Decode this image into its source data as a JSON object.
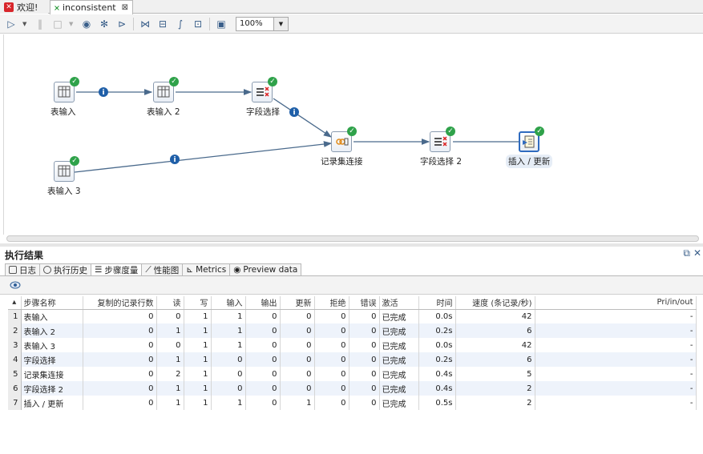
{
  "tabs": [
    {
      "label": "欢迎!",
      "icon": "welcome-icon"
    },
    {
      "label": "inconsistent",
      "icon": "transformation-icon",
      "closable": true
    }
  ],
  "toolbar": {
    "icons": [
      "run-icon",
      "run-options-icon",
      "pause-icon",
      "stop-icon",
      "stop-options-icon",
      "preview-icon",
      "debug-icon",
      "replay-icon",
      "verify-icon",
      "impact-icon",
      "sql-icon",
      "explore-db-icon",
      "show-results-icon"
    ],
    "zoom": "100%"
  },
  "canvas": {
    "nodes": [
      {
        "id": "n1",
        "label": "表输入",
        "type": "table-input"
      },
      {
        "id": "n2",
        "label": "表输入 2",
        "type": "table-input"
      },
      {
        "id": "n3",
        "label": "字段选择",
        "type": "select-values"
      },
      {
        "id": "n4",
        "label": "表输入 3",
        "type": "table-input"
      },
      {
        "id": "n5",
        "label": "记录集连接",
        "type": "merge-join"
      },
      {
        "id": "n6",
        "label": "字段选择 2",
        "type": "select-values"
      },
      {
        "id": "n7",
        "label": "插入 / 更新",
        "type": "insert-update",
        "selected": true
      }
    ],
    "hops": [
      {
        "from": "n1",
        "to": "n2",
        "info": true
      },
      {
        "from": "n2",
        "to": "n3",
        "info": false
      },
      {
        "from": "n3",
        "to": "n5",
        "info": true
      },
      {
        "from": "n4",
        "to": "n5",
        "info": true
      },
      {
        "from": "n5",
        "to": "n6",
        "info": false
      },
      {
        "from": "n6",
        "to": "n7",
        "info": false
      }
    ]
  },
  "results": {
    "title": "执行结果",
    "tabs": [
      {
        "label": "日志",
        "icon": "log-icon"
      },
      {
        "label": "执行历史",
        "icon": "history-icon"
      },
      {
        "label": "步骤度量",
        "icon": "step-metrics-icon",
        "active": true
      },
      {
        "label": "性能图",
        "icon": "performance-chart-icon"
      },
      {
        "label": "Metrics",
        "icon": "metrics-icon"
      },
      {
        "label": "Preview data",
        "icon": "preview-eye-icon"
      }
    ],
    "columns": [
      "步骤名称",
      "复制的记录行数",
      "读",
      "写",
      "输入",
      "输出",
      "更新",
      "拒绝",
      "错误",
      "激活",
      "时间",
      "速度 (条记录/秒)",
      "Pri/in/out"
    ],
    "rows": [
      [
        "1",
        "表输入",
        "0",
        "0",
        "1",
        "1",
        "0",
        "0",
        "0",
        "0",
        "已完成",
        "0.0s",
        "42",
        "-"
      ],
      [
        "2",
        "表输入 2",
        "0",
        "1",
        "1",
        "1",
        "0",
        "0",
        "0",
        "0",
        "已完成",
        "0.2s",
        "6",
        "-"
      ],
      [
        "3",
        "表输入 3",
        "0",
        "0",
        "1",
        "1",
        "0",
        "0",
        "0",
        "0",
        "已完成",
        "0.0s",
        "42",
        "-"
      ],
      [
        "4",
        "字段选择",
        "0",
        "1",
        "1",
        "0",
        "0",
        "0",
        "0",
        "0",
        "已完成",
        "0.2s",
        "6",
        "-"
      ],
      [
        "5",
        "记录集连接",
        "0",
        "2",
        "1",
        "0",
        "0",
        "0",
        "0",
        "0",
        "已完成",
        "0.4s",
        "5",
        "-"
      ],
      [
        "6",
        "字段选择 2",
        "0",
        "1",
        "1",
        "0",
        "0",
        "0",
        "0",
        "0",
        "已完成",
        "0.4s",
        "2",
        "-"
      ],
      [
        "7",
        "插入 / 更新",
        "0",
        "1",
        "1",
        "1",
        "0",
        "1",
        "0",
        "0",
        "已完成",
        "0.5s",
        "2",
        "-"
      ]
    ]
  }
}
